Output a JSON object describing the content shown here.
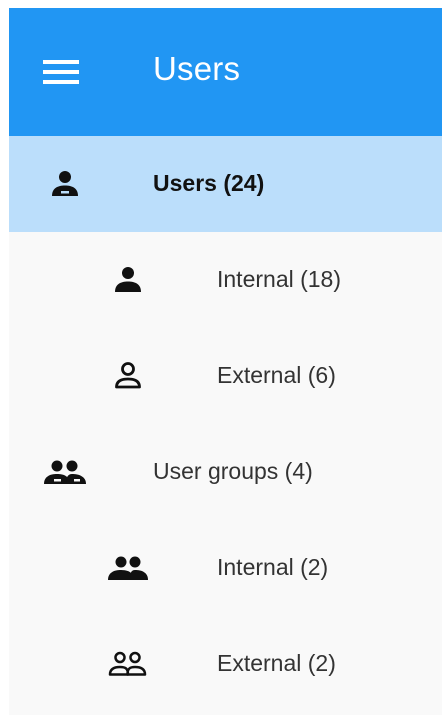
{
  "app_bar": {
    "title": "Users",
    "background": "#2196f3",
    "menu_icon": "hamburger-menu-icon"
  },
  "nav": {
    "selected_background": "#bbdefb",
    "items": [
      {
        "label": "Users (24)",
        "icon": "person-icon",
        "level": 0,
        "selected": true
      },
      {
        "label": "Internal (18)",
        "icon": "person-filled-icon",
        "level": 1,
        "selected": false
      },
      {
        "label": "External (6)",
        "icon": "person-outline-icon",
        "level": 1,
        "selected": false
      },
      {
        "label": "User groups (4)",
        "icon": "people-icon",
        "level": 0,
        "selected": false
      },
      {
        "label": "Internal (2)",
        "icon": "people-filled-icon",
        "level": 1,
        "selected": false
      },
      {
        "label": "External (2)",
        "icon": "people-outline-icon",
        "level": 1,
        "selected": false
      }
    ]
  }
}
